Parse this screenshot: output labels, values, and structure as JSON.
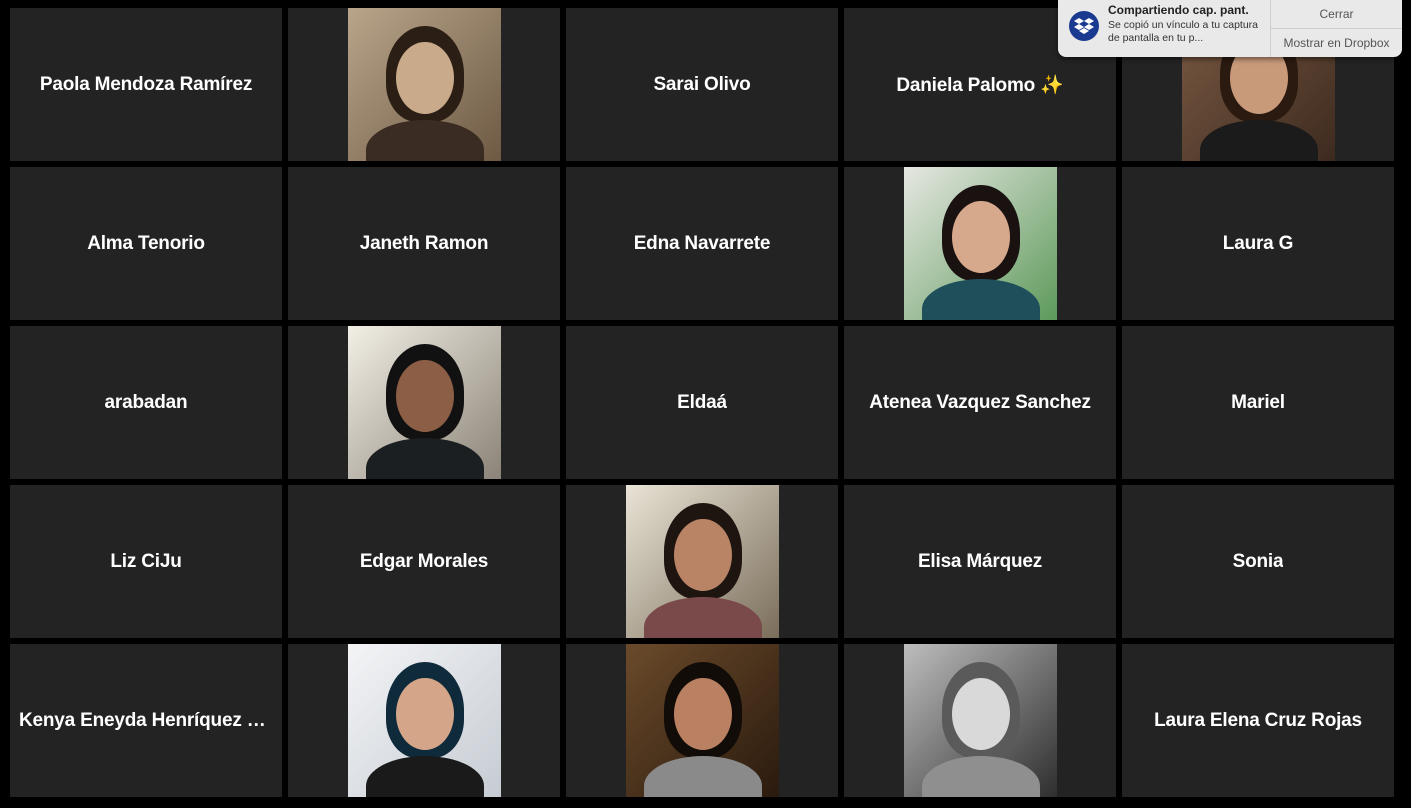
{
  "participants": [
    {
      "type": "name",
      "label": "Paola Mendoza Ramírez"
    },
    {
      "type": "photo",
      "label": "",
      "palette": {
        "bg1": "#b8a58a",
        "bg2": "#6e5a44",
        "hair": "#2b1e15",
        "skin": "#c9ab8c",
        "body": "#3a2c22"
      }
    },
    {
      "type": "name",
      "label": "Sarai Olivo"
    },
    {
      "type": "name",
      "label": "Daniela Palomo ✨"
    },
    {
      "type": "photo",
      "label": "",
      "palette": {
        "bg1": "#7a5a43",
        "bg2": "#3d2a1f",
        "hair": "#2a1a10",
        "skin": "#c89a7a",
        "body": "#1b1b1b"
      }
    },
    {
      "type": "name",
      "label": "Alma Tenorio"
    },
    {
      "type": "name",
      "label": "Janeth Ramon"
    },
    {
      "type": "name",
      "label": "Edna Navarrete"
    },
    {
      "type": "photo",
      "label": "",
      "palette": {
        "bg1": "#e6e7e2",
        "bg2": "#5d9a5a",
        "hair": "#1a1210",
        "skin": "#d7a98c",
        "body": "#1f4f5b"
      }
    },
    {
      "type": "name",
      "label": "Laura G"
    },
    {
      "type": "name",
      "label": "arabadan"
    },
    {
      "type": "photo",
      "label": "",
      "palette": {
        "bg1": "#f2efe6",
        "bg2": "#8b8377",
        "hair": "#111111",
        "skin": "#8c5e45",
        "body": "#1c1f22"
      }
    },
    {
      "type": "name",
      "label": "Eldaá"
    },
    {
      "type": "name",
      "label": "Atenea Vazquez Sanchez"
    },
    {
      "type": "name",
      "label": "Mariel"
    },
    {
      "type": "name",
      "label": "Liz CiJu"
    },
    {
      "type": "name",
      "label": "Edgar Morales"
    },
    {
      "type": "photo",
      "label": "",
      "palette": {
        "bg1": "#e9e4d6",
        "bg2": "#7a6d5a",
        "hair": "#1e1410",
        "skin": "#b98466",
        "body": "#7a4a4a"
      }
    },
    {
      "type": "name",
      "label": "Elisa Márquez"
    },
    {
      "type": "name",
      "label": "Sonia"
    },
    {
      "type": "name",
      "label": "Kenya Eneyda Henríquez M..."
    },
    {
      "type": "photo",
      "label": "",
      "palette": {
        "bg1": "#f3f4f6",
        "bg2": "#c6ccd3",
        "hair": "#0f2a3a",
        "skin": "#d4a589",
        "body": "#1a1a1a"
      }
    },
    {
      "type": "photo",
      "label": "",
      "palette": {
        "bg1": "#6a4a2a",
        "bg2": "#2a1a0e",
        "hair": "#120c08",
        "skin": "#b98062",
        "body": "#8a8a8a"
      }
    },
    {
      "type": "photo",
      "label": "",
      "palette": {
        "bg1": "#bdbdbd",
        "bg2": "#2e2e2e",
        "hair": "#5a5a5a",
        "skin": "#d9d9d9",
        "body": "#8f8f8f"
      }
    },
    {
      "type": "name",
      "label": "Laura Elena Cruz Rojas"
    }
  ],
  "notification": {
    "title": "Compartiendo cap. pant.",
    "body": "Se copió un vínculo a tu captura de pantalla en tu p...",
    "close_label": "Cerrar",
    "show_label": "Mostrar en Dropbox",
    "icon": "dropbox-icon",
    "icon_color": "#1a3a8f"
  },
  "colors": {
    "background": "#000000",
    "tile": "#232323",
    "name_text": "#ffffff"
  }
}
